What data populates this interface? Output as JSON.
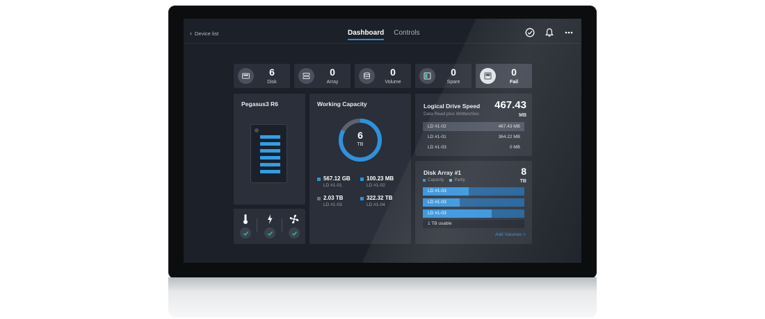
{
  "colors": {
    "accent": "#2e8fd9",
    "capacity": "#2e91dc",
    "parity": "#1d5f98",
    "check": "#3ecf9e"
  },
  "header": {
    "back_label": "Device list",
    "tabs": [
      {
        "label": "Dashboard",
        "active": true
      },
      {
        "label": "Controls",
        "active": false
      }
    ],
    "icons": [
      "checkmark-circle-icon",
      "bell-icon",
      "more-icon"
    ]
  },
  "stats": [
    {
      "value": "6",
      "label": "Disk",
      "icon": "disk-icon"
    },
    {
      "value": "0",
      "label": "Array",
      "icon": "array-icon"
    },
    {
      "value": "0",
      "label": "Volume",
      "icon": "volume-icon"
    },
    {
      "value": "0",
      "label": "Spare",
      "icon": "spare-icon"
    },
    {
      "value": "0",
      "label": "Fail",
      "icon": "fail-disk-icon"
    }
  ],
  "device": {
    "name": "Pegasus3 R6",
    "bays": 6
  },
  "status": [
    {
      "icon": "thermometer-icon",
      "ok": true
    },
    {
      "icon": "power-bolt-icon",
      "ok": true
    },
    {
      "icon": "fan-icon",
      "ok": true
    }
  ],
  "capacity": {
    "title": "Working Capacity",
    "total": "6",
    "unit": "TB",
    "used_fraction": 0.83,
    "items": [
      {
        "value": "567.12 GB",
        "label": "LD #1-01",
        "color": "#2e91dc"
      },
      {
        "value": "100.23 MB",
        "label": "LD #1-02",
        "color": "#2e91dc"
      },
      {
        "value": "2.03 TB",
        "label": "LD #1-03",
        "color": "#6a7180"
      },
      {
        "value": "322.32 TB",
        "label": "LD #1-04",
        "color": "#2e91dc"
      }
    ]
  },
  "speed": {
    "title": "Logical Drive Speed",
    "subtitle": "Data Read plus Written/Sec",
    "value": "467.43",
    "unit": "MB",
    "rows": [
      {
        "name": "LD #1-02",
        "value": "467.43 MB",
        "highlight": true
      },
      {
        "name": "LD #1-01",
        "value": "364.22 MB",
        "highlight": false
      },
      {
        "name": "LD #1-03",
        "value": "0 MB",
        "highlight": false
      }
    ]
  },
  "array": {
    "title": "Disk Array #1",
    "value": "8",
    "unit": "TB",
    "legend_capacity": "Capacity",
    "legend_parity": "Parity",
    "rows": [
      {
        "name": "LD #1-03",
        "fill": 0.45
      },
      {
        "name": "LD #1-03",
        "fill": 0.36
      },
      {
        "name": "LD #1-03",
        "fill": 0.68
      }
    ],
    "usable": "1 TB usable",
    "add_link": "Add Volumes >"
  }
}
